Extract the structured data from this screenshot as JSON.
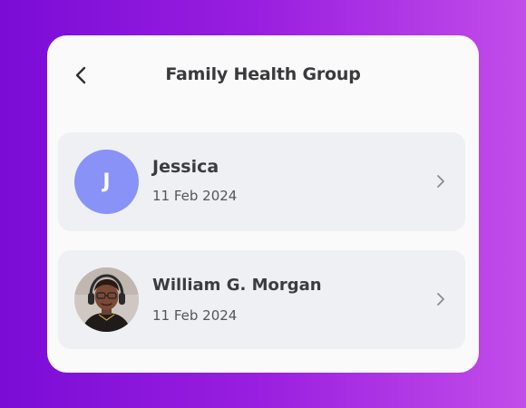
{
  "header": {
    "title": "Family Health Group",
    "back_icon": "chevron-left-icon"
  },
  "members": [
    {
      "name": "Jessica",
      "date": "11 Feb 2024",
      "avatar_initial": "J",
      "avatar_color": "#8892f7"
    },
    {
      "name": "William G. Morgan",
      "date": "11 Feb 2024",
      "avatar_type": "photo"
    }
  ],
  "colors": {
    "card_background": "#fafafb",
    "row_background": "#eff0f3",
    "page_gradient_start": "#7a0cd6",
    "page_gradient_end": "#c24de9"
  }
}
